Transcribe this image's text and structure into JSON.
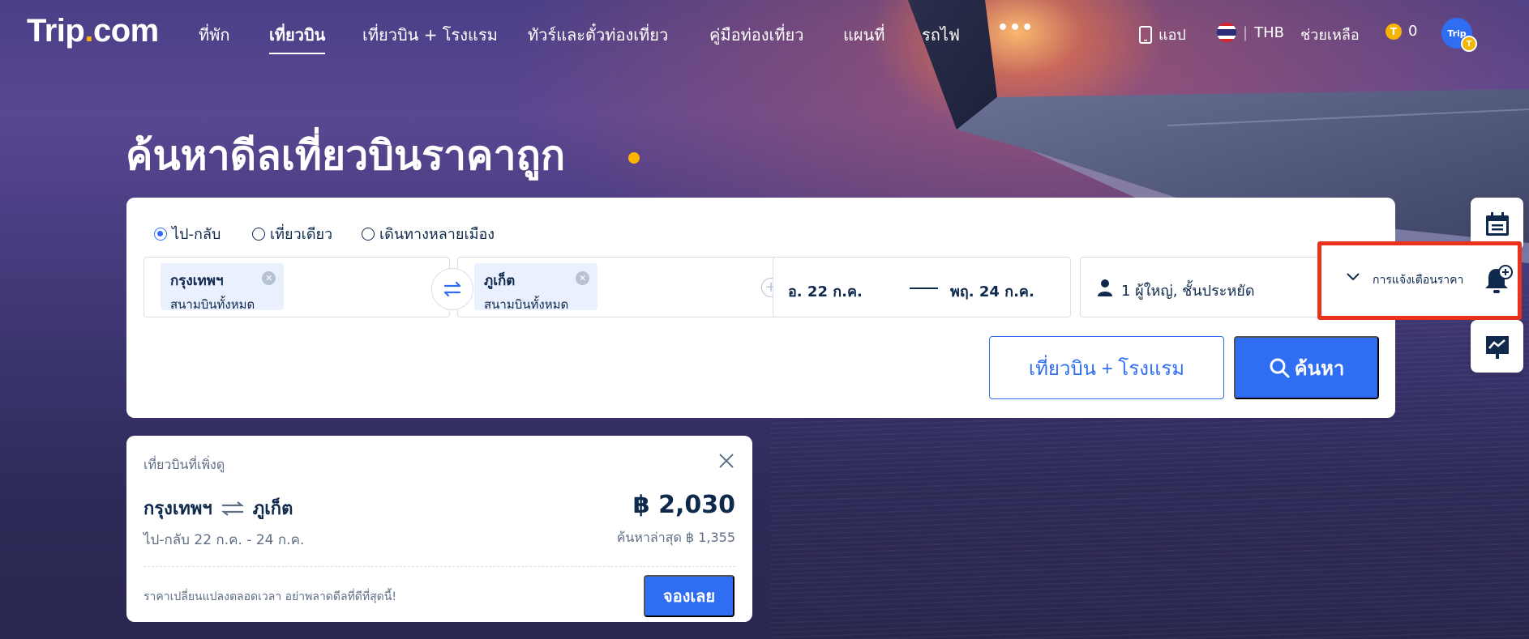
{
  "brand": {
    "logo_main": "Trip",
    "logo_dot": ".",
    "logo_tail": "com"
  },
  "nav": {
    "items": [
      {
        "label": "ที่พัก",
        "active": false
      },
      {
        "label": "เที่ยวบิน",
        "active": true
      },
      {
        "label": "เที่ยวบิน + โรงแรม",
        "active": false
      },
      {
        "label": "ทัวร์และตั๋วท่องเที่ยว",
        "active": false
      },
      {
        "label": "คู่มือท่องเที่ยว",
        "active": false
      },
      {
        "label": "แผนที่",
        "active": false
      },
      {
        "label": "รถไฟ",
        "active": false
      }
    ],
    "more": "•••",
    "app_label": "แอป",
    "currency": "THB",
    "help": "ช่วยเหลือ",
    "coin_symbol": "T",
    "coins": "0",
    "avatar_text": "Trip",
    "avatar_badge": "T"
  },
  "hero": {
    "title": "ค้นหาดีลเที่ยวบินราคาถูก"
  },
  "search": {
    "trip_types": [
      {
        "label": "ไป-กลับ",
        "selected": true
      },
      {
        "label": "เที่ยวเดียว",
        "selected": false
      },
      {
        "label": "เดินทางหลายเมือง",
        "selected": false
      }
    ],
    "origin": {
      "city": "กรุงเทพฯ",
      "airports": "สนามบินทั้งหมด"
    },
    "destination": {
      "city": "ภูเก็ต",
      "airports": "สนามบินทั้งหมด"
    },
    "depart_date": "อ. 22 ก.ค.",
    "return_date": "พฤ. 24 ก.ค.",
    "passengers": "1 ผู้ใหญ่, ชั้นประหยัด",
    "combo_button": "เที่ยวบิน + โรงแรม",
    "search_button": "ค้นหา"
  },
  "side_tools": {
    "price_alert_label": "การแจ้งเตือนราคา"
  },
  "recent": {
    "heading": "เที่ยวบินที่เพิ่งดู",
    "from": "กรุงเทพฯ",
    "to": "ภูเก็ต",
    "dates": "ไป-กลับ  22 ก.ค. - 24 ก.ค.",
    "price": "฿ 2,030",
    "lowest": "ค้นหาล่าสุด ฿ 1,355",
    "note": "ราคาเปลี่ยนแปลงตลอดเวลา อย่าพลาดดีลที่ดีที่สุดนี้!",
    "book_button": "จองเลย"
  },
  "colors": {
    "accent": "#2f6df2",
    "brand_dot": "#ffb400",
    "highlight": "#e8321e",
    "text_dark": "#0f294d"
  }
}
